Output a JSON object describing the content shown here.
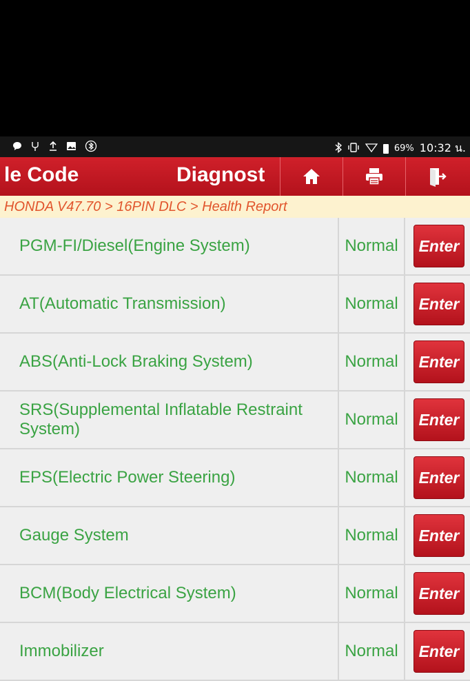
{
  "status_bar": {
    "left_icons": [
      "chat-icon",
      "usb-icon",
      "upload-icon",
      "image-icon",
      "bluetooth-circle-icon"
    ],
    "right_icons": [
      "bluetooth-icon",
      "vibrate-icon",
      "wifi-icon",
      "battery-icon"
    ],
    "battery_percent": "69%",
    "time": "10:32 น."
  },
  "header": {
    "title_left": "le Code",
    "title_mid": "Diagnost",
    "buttons": [
      {
        "name": "home",
        "icon": "home-icon"
      },
      {
        "name": "print",
        "icon": "print-icon"
      },
      {
        "name": "exit",
        "icon": "exit-icon"
      }
    ],
    "colors": {
      "bar": "#c2161f",
      "text": "#ffffff"
    }
  },
  "breadcrumb": "HONDA V47.70 > 16PIN DLC > Health Report",
  "systems": [
    {
      "name": "PGM-FI/Diesel(Engine System)",
      "status": "Normal",
      "action": "Enter"
    },
    {
      "name": "AT(Automatic Transmission)",
      "status": "Normal",
      "action": "Enter"
    },
    {
      "name": "ABS(Anti-Lock Braking System)",
      "status": "Normal",
      "action": "Enter"
    },
    {
      "name": "SRS(Supplemental Inflatable Restraint System)",
      "status": "Normal",
      "action": "Enter"
    },
    {
      "name": "EPS(Electric Power Steering)",
      "status": "Normal",
      "action": "Enter"
    },
    {
      "name": "Gauge System",
      "status": "Normal",
      "action": "Enter"
    },
    {
      "name": "BCM(Body Electrical System)",
      "status": "Normal",
      "action": "Enter"
    },
    {
      "name": "Immobilizer",
      "status": "Normal",
      "action": "Enter"
    }
  ],
  "colors": {
    "accent_red": "#c2161f",
    "status_green": "#3aa343",
    "breadcrumb_text": "#e1552d",
    "breadcrumb_bg": "#fdf2cf",
    "row_bg": "#efefef"
  }
}
